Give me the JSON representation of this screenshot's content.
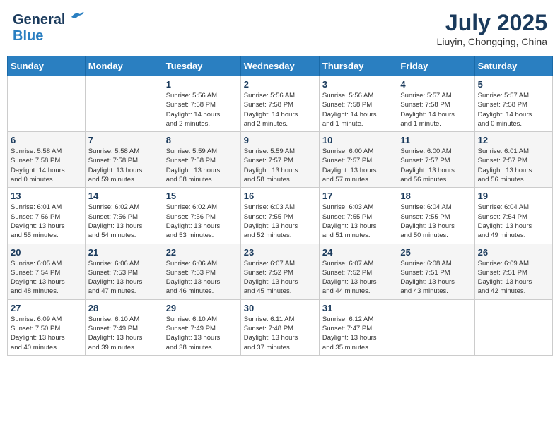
{
  "header": {
    "logo_general": "General",
    "logo_blue": "Blue",
    "month": "July 2025",
    "location": "Liuyin, Chongqing, China"
  },
  "weekdays": [
    "Sunday",
    "Monday",
    "Tuesday",
    "Wednesday",
    "Thursday",
    "Friday",
    "Saturday"
  ],
  "weeks": [
    [
      {
        "day": "",
        "info": ""
      },
      {
        "day": "",
        "info": ""
      },
      {
        "day": "1",
        "info": "Sunrise: 5:56 AM\nSunset: 7:58 PM\nDaylight: 14 hours\nand 2 minutes."
      },
      {
        "day": "2",
        "info": "Sunrise: 5:56 AM\nSunset: 7:58 PM\nDaylight: 14 hours\nand 2 minutes."
      },
      {
        "day": "3",
        "info": "Sunrise: 5:56 AM\nSunset: 7:58 PM\nDaylight: 14 hours\nand 1 minute."
      },
      {
        "day": "4",
        "info": "Sunrise: 5:57 AM\nSunset: 7:58 PM\nDaylight: 14 hours\nand 1 minute."
      },
      {
        "day": "5",
        "info": "Sunrise: 5:57 AM\nSunset: 7:58 PM\nDaylight: 14 hours\nand 0 minutes."
      }
    ],
    [
      {
        "day": "6",
        "info": "Sunrise: 5:58 AM\nSunset: 7:58 PM\nDaylight: 14 hours\nand 0 minutes."
      },
      {
        "day": "7",
        "info": "Sunrise: 5:58 AM\nSunset: 7:58 PM\nDaylight: 13 hours\nand 59 minutes."
      },
      {
        "day": "8",
        "info": "Sunrise: 5:59 AM\nSunset: 7:58 PM\nDaylight: 13 hours\nand 58 minutes."
      },
      {
        "day": "9",
        "info": "Sunrise: 5:59 AM\nSunset: 7:57 PM\nDaylight: 13 hours\nand 58 minutes."
      },
      {
        "day": "10",
        "info": "Sunrise: 6:00 AM\nSunset: 7:57 PM\nDaylight: 13 hours\nand 57 minutes."
      },
      {
        "day": "11",
        "info": "Sunrise: 6:00 AM\nSunset: 7:57 PM\nDaylight: 13 hours\nand 56 minutes."
      },
      {
        "day": "12",
        "info": "Sunrise: 6:01 AM\nSunset: 7:57 PM\nDaylight: 13 hours\nand 56 minutes."
      }
    ],
    [
      {
        "day": "13",
        "info": "Sunrise: 6:01 AM\nSunset: 7:56 PM\nDaylight: 13 hours\nand 55 minutes."
      },
      {
        "day": "14",
        "info": "Sunrise: 6:02 AM\nSunset: 7:56 PM\nDaylight: 13 hours\nand 54 minutes."
      },
      {
        "day": "15",
        "info": "Sunrise: 6:02 AM\nSunset: 7:56 PM\nDaylight: 13 hours\nand 53 minutes."
      },
      {
        "day": "16",
        "info": "Sunrise: 6:03 AM\nSunset: 7:55 PM\nDaylight: 13 hours\nand 52 minutes."
      },
      {
        "day": "17",
        "info": "Sunrise: 6:03 AM\nSunset: 7:55 PM\nDaylight: 13 hours\nand 51 minutes."
      },
      {
        "day": "18",
        "info": "Sunrise: 6:04 AM\nSunset: 7:55 PM\nDaylight: 13 hours\nand 50 minutes."
      },
      {
        "day": "19",
        "info": "Sunrise: 6:04 AM\nSunset: 7:54 PM\nDaylight: 13 hours\nand 49 minutes."
      }
    ],
    [
      {
        "day": "20",
        "info": "Sunrise: 6:05 AM\nSunset: 7:54 PM\nDaylight: 13 hours\nand 48 minutes."
      },
      {
        "day": "21",
        "info": "Sunrise: 6:06 AM\nSunset: 7:53 PM\nDaylight: 13 hours\nand 47 minutes."
      },
      {
        "day": "22",
        "info": "Sunrise: 6:06 AM\nSunset: 7:53 PM\nDaylight: 13 hours\nand 46 minutes."
      },
      {
        "day": "23",
        "info": "Sunrise: 6:07 AM\nSunset: 7:52 PM\nDaylight: 13 hours\nand 45 minutes."
      },
      {
        "day": "24",
        "info": "Sunrise: 6:07 AM\nSunset: 7:52 PM\nDaylight: 13 hours\nand 44 minutes."
      },
      {
        "day": "25",
        "info": "Sunrise: 6:08 AM\nSunset: 7:51 PM\nDaylight: 13 hours\nand 43 minutes."
      },
      {
        "day": "26",
        "info": "Sunrise: 6:09 AM\nSunset: 7:51 PM\nDaylight: 13 hours\nand 42 minutes."
      }
    ],
    [
      {
        "day": "27",
        "info": "Sunrise: 6:09 AM\nSunset: 7:50 PM\nDaylight: 13 hours\nand 40 minutes."
      },
      {
        "day": "28",
        "info": "Sunrise: 6:10 AM\nSunset: 7:49 PM\nDaylight: 13 hours\nand 39 minutes."
      },
      {
        "day": "29",
        "info": "Sunrise: 6:10 AM\nSunset: 7:49 PM\nDaylight: 13 hours\nand 38 minutes."
      },
      {
        "day": "30",
        "info": "Sunrise: 6:11 AM\nSunset: 7:48 PM\nDaylight: 13 hours\nand 37 minutes."
      },
      {
        "day": "31",
        "info": "Sunrise: 6:12 AM\nSunset: 7:47 PM\nDaylight: 13 hours\nand 35 minutes."
      },
      {
        "day": "",
        "info": ""
      },
      {
        "day": "",
        "info": ""
      }
    ]
  ]
}
